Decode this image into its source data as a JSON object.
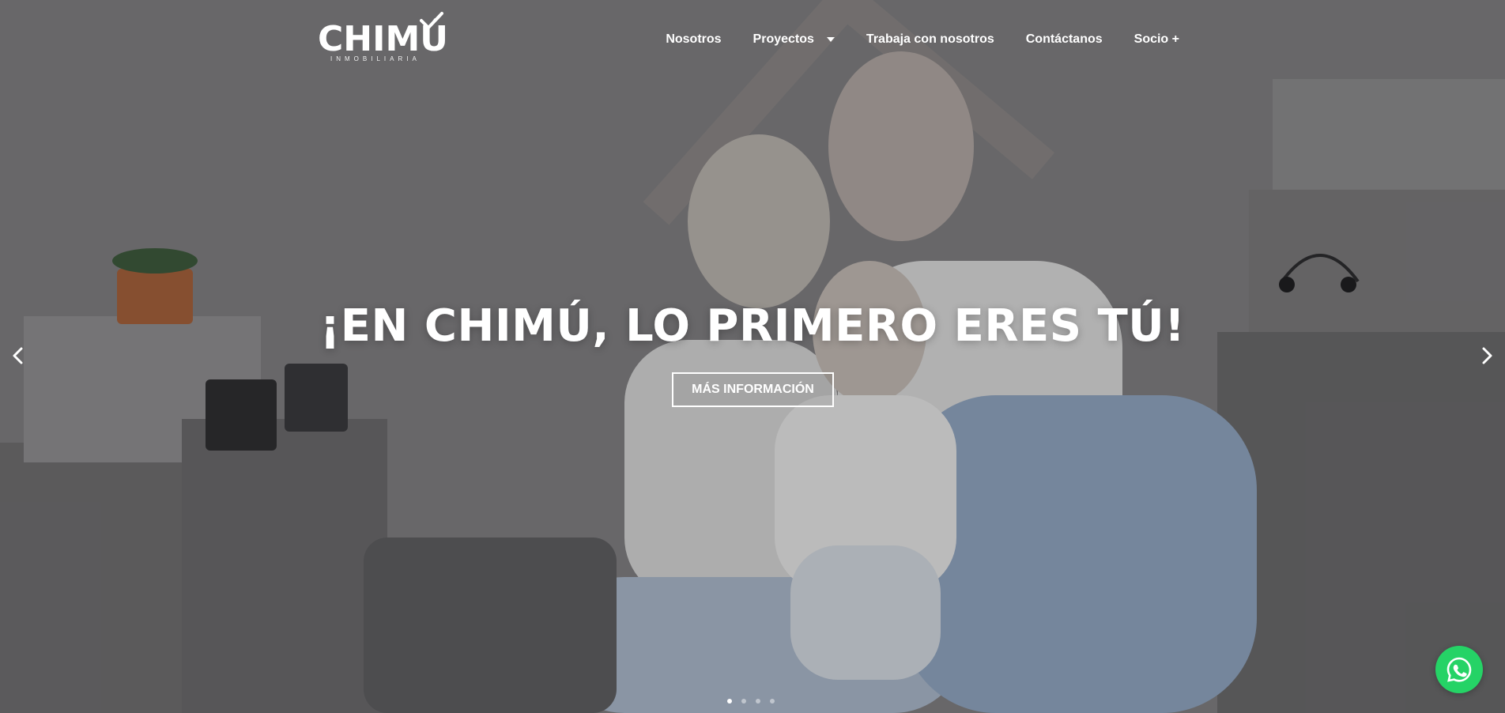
{
  "brand": {
    "name": "CHIMÚ",
    "tagline": "INMOBILIARIA"
  },
  "nav": {
    "items": [
      {
        "label": "Nosotros",
        "has_dropdown": false
      },
      {
        "label": "Proyectos",
        "has_dropdown": true
      },
      {
        "label": "Trabaja con nosotros",
        "has_dropdown": false
      },
      {
        "label": "Contáctanos",
        "has_dropdown": false
      },
      {
        "label": "Socio +",
        "has_dropdown": false
      }
    ]
  },
  "hero": {
    "headline": "¡EN CHIMÚ, LO PRIMERO ERES TÚ!",
    "cta_label": "MÁS INFORMACIÓN",
    "slides_total": 4,
    "active_slide": 1
  },
  "icons": {
    "prev": "chevron-left-icon",
    "next": "chevron-right-icon",
    "caret": "caret-down-icon",
    "whatsapp": "whatsapp-icon"
  },
  "colors": {
    "whatsapp": "#25d366",
    "text": "#ffffff"
  }
}
